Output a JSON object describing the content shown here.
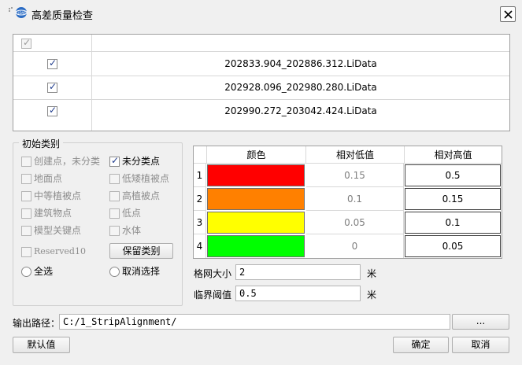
{
  "window": {
    "title": "高差质量检查",
    "icon_text": "LIDAR"
  },
  "file_table": {
    "rows": [
      {
        "name": "202833.904_202886.312.LiData",
        "checked": true
      },
      {
        "name": "202928.096_202980.280.LiData",
        "checked": true
      },
      {
        "name": "202990.272_203042.424.LiData",
        "checked": true
      }
    ]
  },
  "classes": {
    "group_title": "初始类别",
    "left": [
      "创建点，未分类",
      "地面点",
      "中等植被点",
      "建筑物点",
      "模型关键点",
      "Reserved10"
    ],
    "right": [
      "未分类点",
      "低矮植被点",
      "高植被点",
      "低点",
      "水体"
    ],
    "keep_button": "保留类别",
    "select_all": "全选",
    "deselect": "取消选择"
  },
  "color_table": {
    "headers": [
      "颜色",
      "相对低值",
      "相对高值"
    ],
    "rows": [
      {
        "index": "1",
        "color": "#ff0000",
        "low": "0.15",
        "high": "0.5"
      },
      {
        "index": "2",
        "color": "#ff8000",
        "low": "0.1",
        "high": "0.15"
      },
      {
        "index": "3",
        "color": "#ffff00",
        "low": "0.05",
        "high": "0.1"
      },
      {
        "index": "4",
        "color": "#00ff00",
        "low": "0",
        "high": "0.05"
      }
    ]
  },
  "grid": {
    "label": "格网大小",
    "value": "2",
    "unit": "米"
  },
  "threshold": {
    "label": "临界阈值",
    "value": "0.5",
    "unit": "米"
  },
  "output": {
    "label": "输出路径：",
    "value": "C:/1_StripAlignment/",
    "browse_label": "..."
  },
  "buttons": {
    "default": "默认值",
    "ok": "确定",
    "cancel": "取消"
  }
}
